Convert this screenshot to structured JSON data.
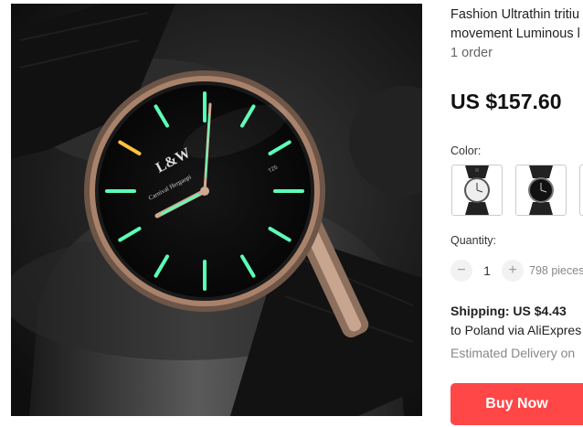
{
  "product": {
    "title_line1": "Fashion Ultrathin tritiu",
    "title_line2": "movement Luminous l",
    "orders": "1 order",
    "price": "US $157.60"
  },
  "color": {
    "label": "Color:",
    "options": [
      {
        "name": "black-strap-white-dial",
        "selected": false
      },
      {
        "name": "black-strap-black-dial",
        "selected": false
      }
    ]
  },
  "quantity": {
    "label": "Quantity:",
    "minus": "−",
    "value": "1",
    "plus": "+",
    "available": "798 pieces"
  },
  "shipping": {
    "title": "Shipping: US $4.43",
    "destination": "to Poland via AliExpres",
    "estimated": "Estimated Delivery on"
  },
  "actions": {
    "buy_now": "Buy Now"
  },
  "watch_face": {
    "logo": "L&W",
    "sub_logo": "Carnival Hergaopi",
    "small_text": "T25"
  },
  "colors": {
    "buy_button": "#ff4747",
    "lume": "#5bffb6",
    "case_rose_gold": "#a9826b"
  }
}
